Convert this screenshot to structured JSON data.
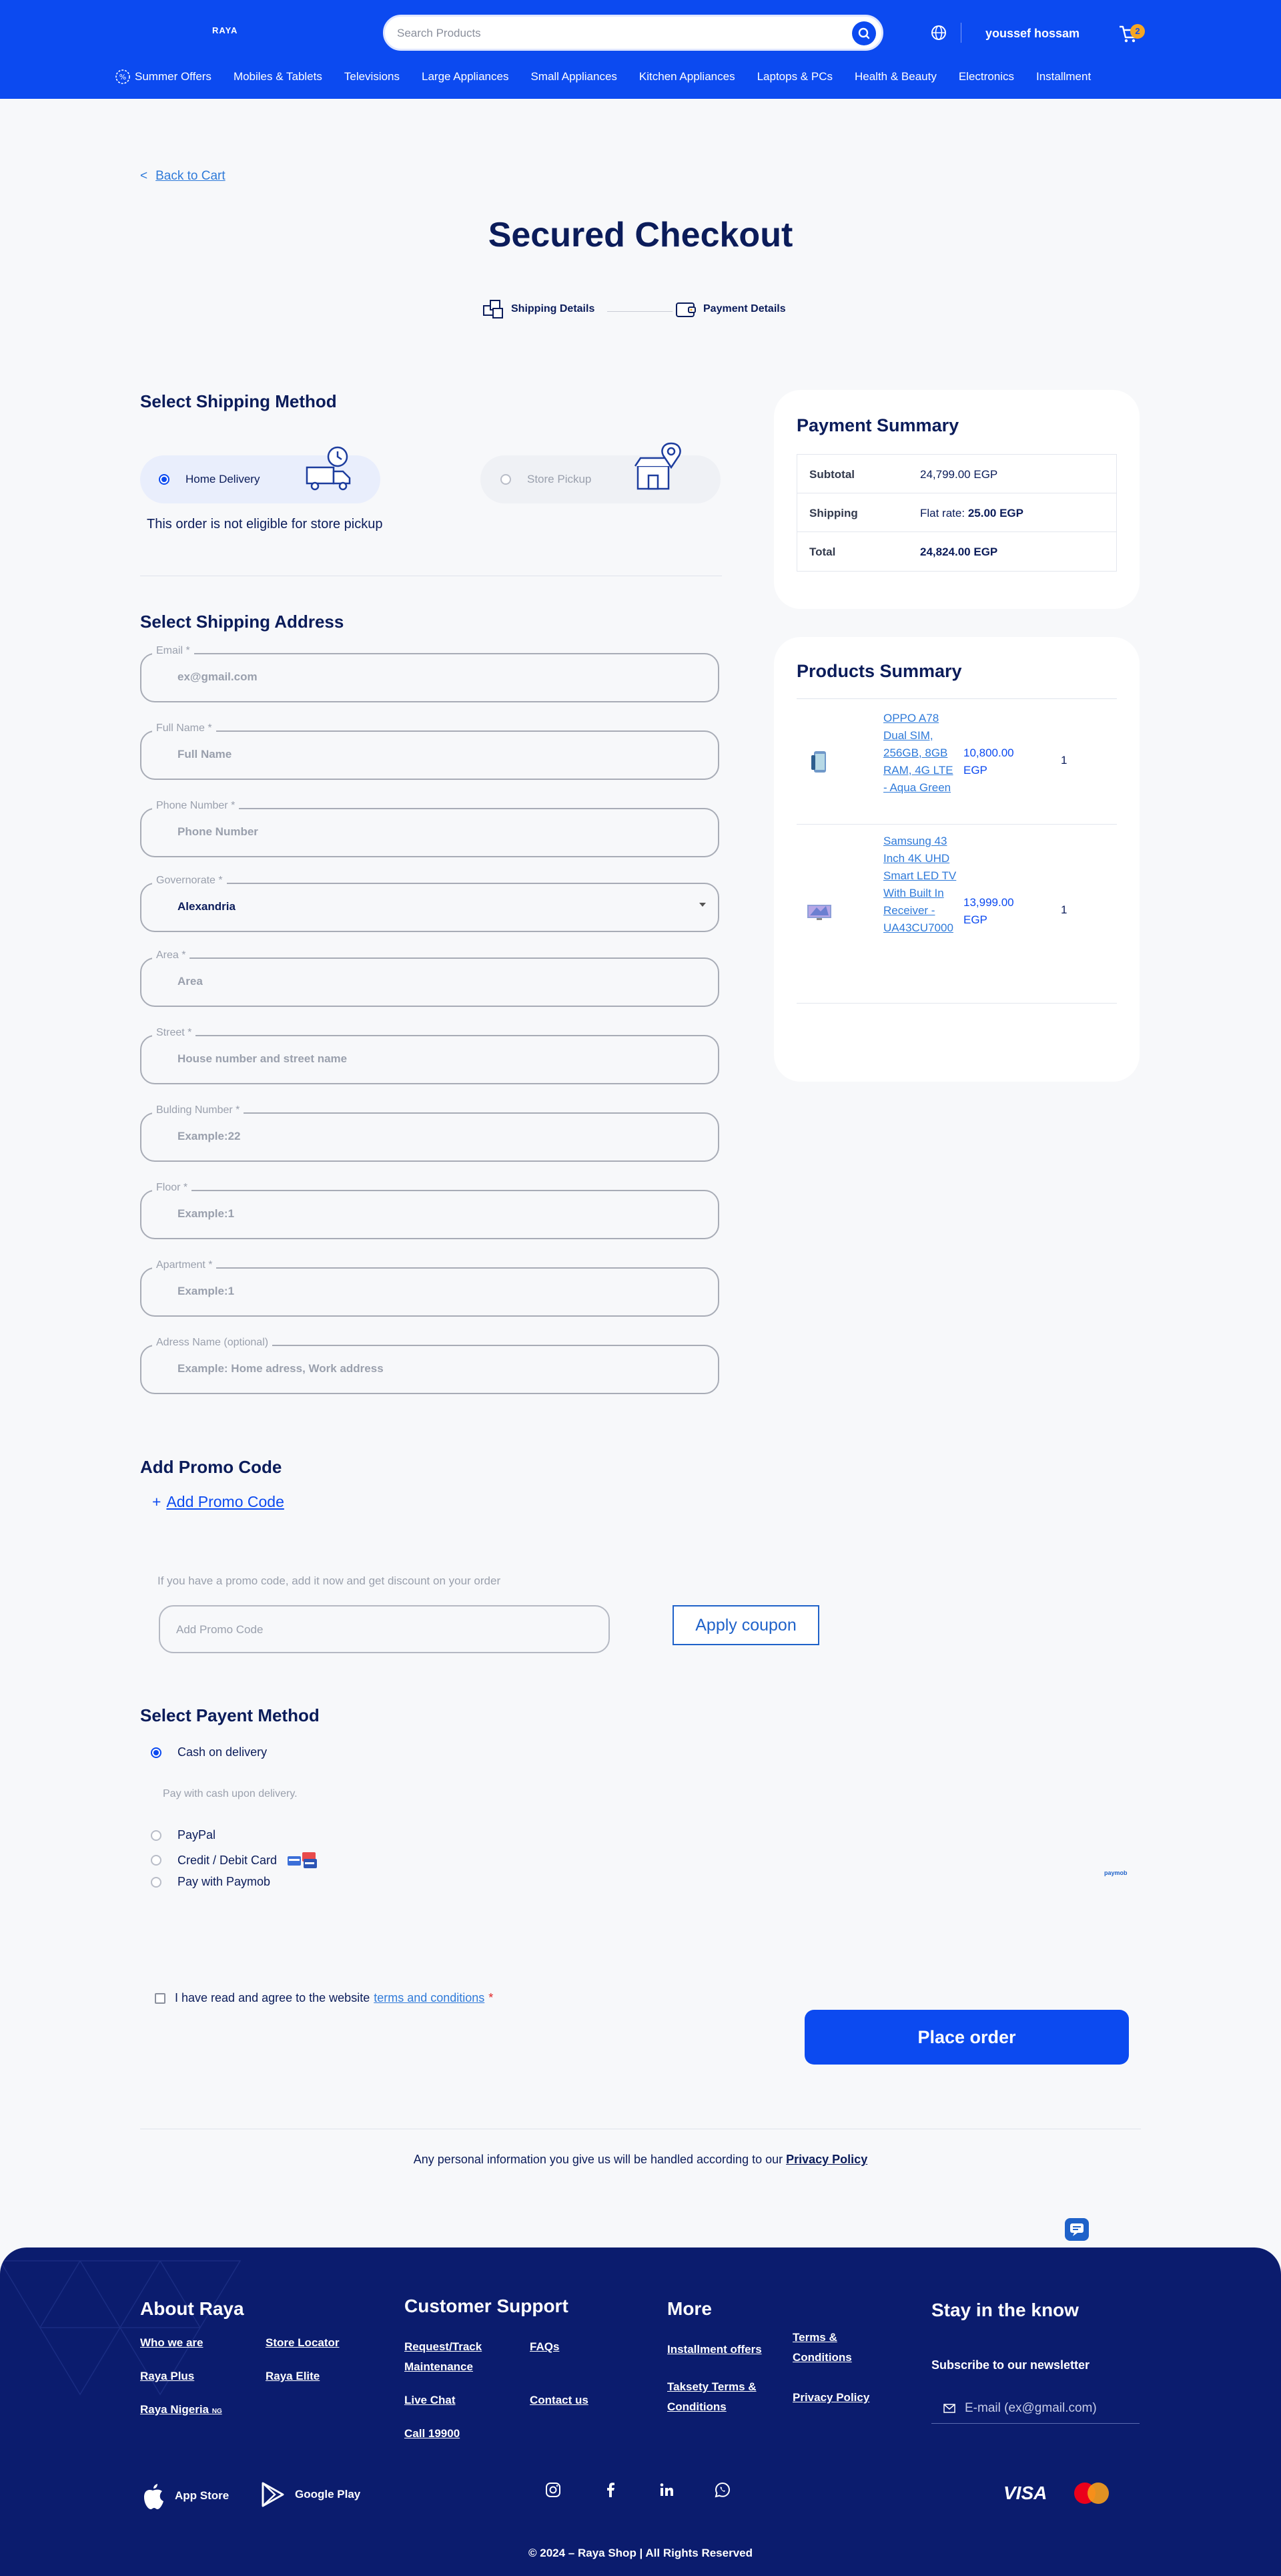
{
  "header": {
    "logo": "RAYA",
    "search_placeholder": "Search Products",
    "user_name": "youssef hossam",
    "cart_count": "2",
    "nav": [
      "Summer Offers",
      "Mobiles & Tablets",
      "Televisions",
      "Large Appliances",
      "Small Appliances",
      "Kitchen Appliances",
      "Laptops & PCs",
      "Health & Beauty",
      "Electronics",
      "Installment"
    ]
  },
  "back_label": "Back to Cart",
  "back_icon": "<",
  "page_title": "Secured Checkout",
  "steps": [
    "Shipping Details",
    "Payment Details"
  ],
  "shipping_method": {
    "title": "Select Shipping Method",
    "options": [
      "Home Delivery",
      "Store Pickup"
    ],
    "selected": "Home Delivery",
    "note": "This order is not eligible for store pickup"
  },
  "shipping_address": {
    "title": "Select Shipping Address",
    "fields": [
      {
        "label": "Email *",
        "value": "",
        "placeholder": "ex@gmail.com"
      },
      {
        "label": "Full Name *",
        "value": "",
        "placeholder": "Full Name"
      },
      {
        "label": "Phone Number *",
        "value": "",
        "placeholder": "Phone Number"
      },
      {
        "label": "Governorate *",
        "value": "Alexandria",
        "placeholder": ""
      },
      {
        "label": "Area *",
        "value": "",
        "placeholder": "Area"
      },
      {
        "label": "Street *",
        "value": "",
        "placeholder": "House number and street name"
      },
      {
        "label": "Bulding Number *",
        "value": "",
        "placeholder": "Example:22"
      },
      {
        "label": "Floor *",
        "value": "",
        "placeholder": "Example:1"
      },
      {
        "label": "Apartment *",
        "value": "",
        "placeholder": "Example:1"
      },
      {
        "label": "Adress Name (optional)",
        "value": "",
        "placeholder": "Example: Home adress, Work address"
      }
    ]
  },
  "payment_summary": {
    "title": "Payment Summary",
    "rows": [
      {
        "key": "Subtotal",
        "value": "24,799.00 EGP"
      },
      {
        "key": "Shipping",
        "prefix": "Flat rate:",
        "value": "25.00 EGP"
      },
      {
        "key": "Total",
        "value": "24,824.00 EGP"
      }
    ]
  },
  "products_summary": {
    "title": "Products Summary",
    "items": [
      {
        "name": "OPPO A78 Dual SIM, 256GB, 8GB RAM, 4G LTE - Aqua Green",
        "price": "10,800.00 EGP",
        "qty": "1"
      },
      {
        "name": "Samsung 43 Inch 4K UHD Smart LED TV With Built In Receiver - UA43CU7000",
        "price": "13,999.00 EGP",
        "qty": "1"
      }
    ]
  },
  "promo": {
    "title": "Add Promo Code",
    "link_prefix": "+",
    "link": "Add Promo Code",
    "hint": "If you have a promo code, add it now and get discount on your order",
    "placeholder": "Add Promo Code",
    "apply_label": "Apply coupon"
  },
  "payment_method": {
    "title": "Select Payent Method",
    "options": [
      "Cash on delivery",
      "PayPal",
      "Credit / Debit Card",
      "Pay with Paymob"
    ],
    "selected": "Cash on delivery",
    "cash_desc": "Pay with cash upon delivery.",
    "paymob_logo": "paymob"
  },
  "terms": {
    "text": "I have read and agree to the website",
    "link": "terms and conditions",
    "required": "*"
  },
  "place_order_label": "Place order",
  "privacy": {
    "text": "Any personal information you give us will be handled according to our",
    "link": "Privacy Policy"
  },
  "footer": {
    "about_title": "About Raya",
    "about_links": [
      "Who we are",
      "Store Locator",
      "Raya Plus",
      "Raya Elite",
      "Raya Nigeria"
    ],
    "nigeria_tag": "NG",
    "support_title": "Customer Support",
    "support_links": [
      "Request/Track Maintenance",
      "FAQs",
      "Live Chat",
      "Contact us",
      "Call 19900"
    ],
    "more_title": "More",
    "more_links": [
      "Installment offers",
      "Terms & Conditions",
      "Taksety Terms & Conditions",
      "Privacy Policy"
    ],
    "stay_title": "Stay in the know",
    "subscribe_label": "Subscribe to our newsletter",
    "email_placeholder": "E-mail (ex@gmail.com)",
    "app_store": "App Store",
    "google_play": "Google Play",
    "visa": "VISA",
    "copyright": "© 2024 – Raya Shop | All Rights Reserved",
    "colors": {
      "bg": "#0b1c6e",
      "mc_red": "#eb001b",
      "mc_orange": "#f79e1b"
    }
  },
  "colors": {
    "brand": "#0c4af0",
    "navy": "#0b1c5a",
    "link": "#2f7ad9",
    "cart_badge": "#f5a623"
  }
}
